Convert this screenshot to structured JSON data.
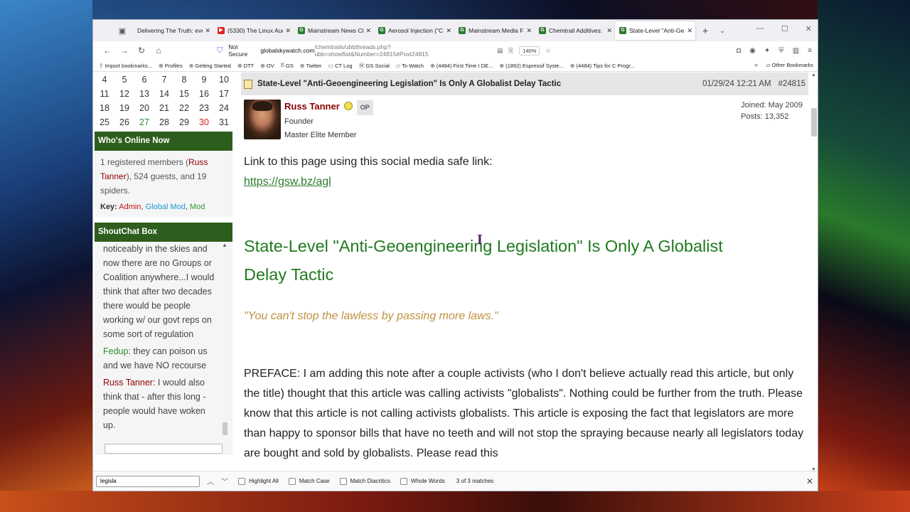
{
  "browser": {
    "tabs": [
      {
        "label": "Delivering The Truth: eve",
        "icon": "page-icon"
      },
      {
        "label": "(5330) The Linux Auc",
        "icon": "youtube-icon"
      },
      {
        "label": "Mainstream News Cl",
        "icon": "gsw-icon"
      },
      {
        "label": "Aerosol Injection (\"C",
        "icon": "gsw-icon"
      },
      {
        "label": "Mainstream Media F",
        "icon": "gsw-icon"
      },
      {
        "label": "Chemtrail Additives:",
        "icon": "gsw-icon"
      },
      {
        "label": "State-Level \"Anti-Ge",
        "icon": "gsw-icon",
        "active": true
      }
    ],
    "url_security": "Not Secure",
    "url_host": "globalskywatch.com",
    "url_path": "/chemtrails/ubbthreads.php?ubb=showflat&Number=24815#Post24815",
    "zoom": "140%",
    "bookmarks": [
      "Import bookmarks...",
      "Profiles",
      "Getting Started",
      "DTT",
      "OV",
      "GS",
      "Twitter",
      "CT Log",
      "GS Social",
      "To Watch",
      "(4484) First Time I DE...",
      "(1892) Espressif Syste...",
      "(4484) Tips for C Progr..."
    ],
    "other_bookmarks": "Other Bookmarks"
  },
  "sidebar": {
    "calendar": [
      [
        "4",
        "5",
        "6",
        "7",
        "8",
        "9",
        "10"
      ],
      [
        "11",
        "12",
        "13",
        "14",
        "15",
        "16",
        "17"
      ],
      [
        "18",
        "19",
        "20",
        "21",
        "22",
        "23",
        "24"
      ],
      [
        "25",
        "26",
        "27",
        "28",
        "29",
        "30",
        "31"
      ]
    ],
    "whos_online_title": "Who's Online Now",
    "online_pre": "1 registered members (",
    "online_user": "Russ Tanner",
    "online_post": "), 524 guests, and 19 spiders.",
    "key_label": "Key:",
    "key_admin": "Admin",
    "key_gmod": "Global Mod",
    "key_mod": "Mod",
    "shoutbox_title": "ShoutChat Box",
    "shout_1": "noticeably in the skies and now there are no Groups or Coalition anywhere...I would think that after two decades there would be people working w/ our govt reps on some sort of regulation",
    "shout_2_user": "Fedup:",
    "shout_2_text": " they can poison us and we have NO recourse",
    "shout_3_user": "Russ Tanner:",
    "shout_3_text": " I would also think that - after this long - people would have woken up."
  },
  "post": {
    "title": "State-Level \"Anti-Geoengineering Legislation\" Is Only A Globalist Delay Tactic",
    "date": "01/29/24 12:21 AM",
    "number": "#24815",
    "author": "Russ Tanner",
    "op_badge": "OP",
    "role": "Founder",
    "rank": "Master Elite Member",
    "joined": "Joined: May 2009",
    "posts": "Posts: 13,352",
    "link_intro": "Link to this page using this social media safe link:",
    "short_link": "https://gsw.bz/agl",
    "heading": "State-Level \"Anti-Geoengineering Legislation\" Is Only A Globalist Delay Tactic",
    "quote": "\"You can't stop the lawless by passing more laws.\"",
    "preface": "PREFACE: I am adding this note after a couple activists (who I don't believe actually read this article, but only the title) thought that this article was calling activists \"globalists\". Nothing could be further from the truth. Please know that this article is not calling activists globalists. This article is exposing the fact that legislators are more than happy to sponsor bills that have no teeth and will not stop the spraying because nearly all legislators today are bought and sold by globalists. Please read this"
  },
  "findbar": {
    "query": "legisla",
    "highlight_all": "Highlight All",
    "match_case": "Match Case",
    "match_diacritics": "Match Diacritics",
    "whole_words": "Whole Words",
    "count": "3 of 3 matches"
  },
  "colors": {
    "panel_header": "#2e5e1e",
    "heading_green": "#1f7a1f",
    "author_red": "#8b0000",
    "quote_gold": "#c09040"
  }
}
